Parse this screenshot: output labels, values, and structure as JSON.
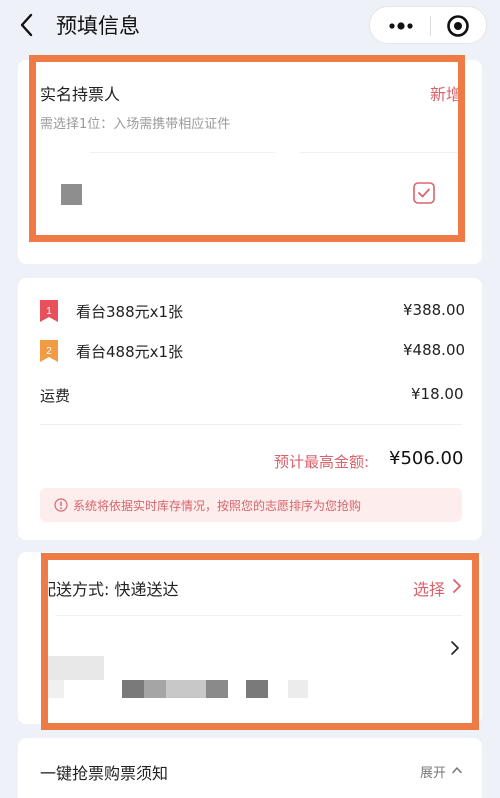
{
  "header": {
    "title": "预填信息",
    "icons": {
      "back": "chevron-left-icon",
      "more": "more-dots-icon",
      "close": "target-circle-icon"
    }
  },
  "ticket_holder": {
    "title": "实名持票人",
    "add_label": "新增",
    "hint": "需选择1位：入场需携带相应证件",
    "selected": true,
    "icon": "checkbox-checked-icon"
  },
  "order": {
    "items": [
      {
        "rank": "1",
        "label": "看台388元x1张",
        "price": "¥388.00",
        "color": "#e8505b"
      },
      {
        "rank": "2",
        "label": "看台488元x1张",
        "price": "¥488.00",
        "color": "#f39a45"
      }
    ],
    "shipping_label": "运费",
    "shipping_price": "¥18.00",
    "total_label": "预计最高金额:",
    "total_value": "¥506.00",
    "notice": "系统将依据实时库存情况，按照您的志愿排序为您抢购",
    "notice_icon": "info-circle-icon"
  },
  "delivery": {
    "label": "配送方式: 快递送达",
    "select_label": "选择",
    "icon": "chevron-right-icon"
  },
  "guide": {
    "label": "一键抢票购票须知",
    "expand_label": "展开",
    "icon": "chevron-up-icon"
  },
  "colors": {
    "accent": "#d9636b",
    "highlight_frame": "#ee7a45",
    "background": "#eef1f8"
  }
}
